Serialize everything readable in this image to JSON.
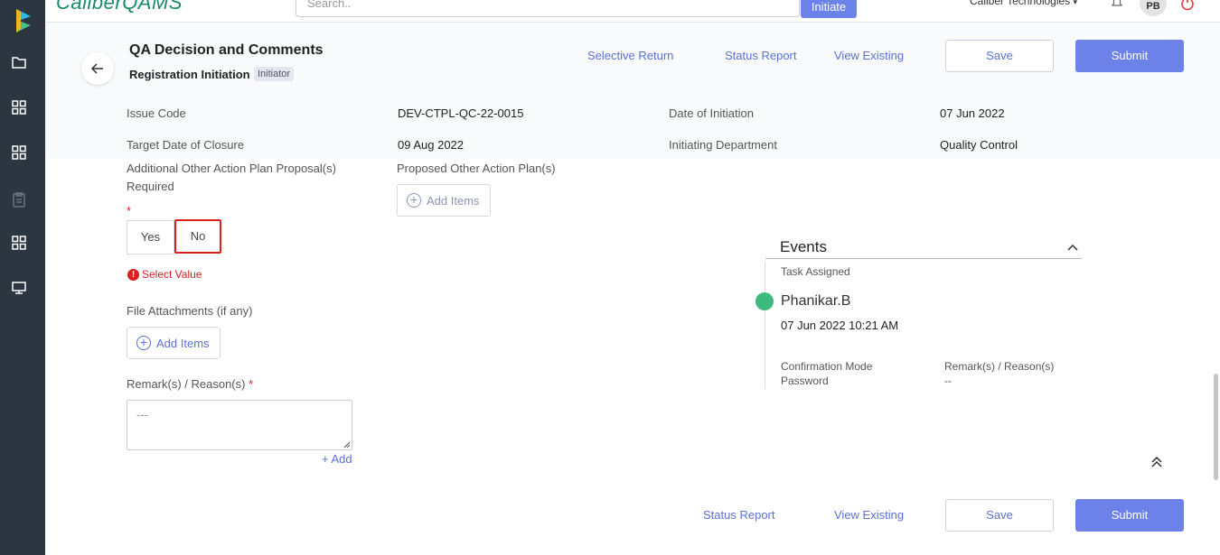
{
  "topbar": {
    "brand": "CaliberQAMS",
    "search_placeholder": "Search..",
    "initiate_label": "Initiate",
    "company": "Caliber Technologies",
    "avatar_initials": "PB"
  },
  "header": {
    "title": "QA Decision and Comments",
    "subtitle": "Registration Initiation",
    "badge": "Initiator",
    "links": {
      "selective_return": "Selective Return",
      "status_report": "Status Report",
      "view_existing": "View Existing"
    },
    "save_label": "Save",
    "submit_label": "Submit"
  },
  "meta": {
    "issue_code_label": "Issue Code",
    "issue_code_value": "DEV-CTPL-QC-22-0015",
    "date_initiation_label": "Date of Initiation",
    "date_initiation_value": "07 Jun 2022",
    "target_date_label": "Target Date of Closure",
    "target_date_value": "09 Aug 2022",
    "dept_label": "Initiating Department",
    "dept_value": "Quality Control"
  },
  "form": {
    "additional_label": "Additional Other Action Plan Proposal(s) Required",
    "required_mark": "*",
    "yes_label": "Yes",
    "no_label": "No",
    "error_text": "Select Value",
    "proposed_label": "Proposed Other Action Plan(s)",
    "add_items_label": "Add Items",
    "file_label": "File Attachments (if any)",
    "remarks_label": "Remark(s) / Reason(s)",
    "remarks_placeholder": "---",
    "add_link": "+ Add"
  },
  "events": {
    "title": "Events",
    "task_assigned": "Task Assigned",
    "user": "Phanikar.B",
    "datetime": "07 Jun 2022 10:21 AM",
    "confirmation_label": "Confirmation Mode",
    "confirmation_value": "Password",
    "remarks_label": "Remark(s) / Reason(s)",
    "remarks_value": "--"
  },
  "footer": {
    "status_report": "Status Report",
    "view_existing": "View Existing",
    "save_label": "Save",
    "submit_label": "Submit"
  },
  "colors": {
    "sidebar": "#2b3640",
    "primary": "#6c82e9",
    "link": "#5a71d6",
    "error": "#d9201f",
    "event_dot": "#3dbb7e"
  }
}
